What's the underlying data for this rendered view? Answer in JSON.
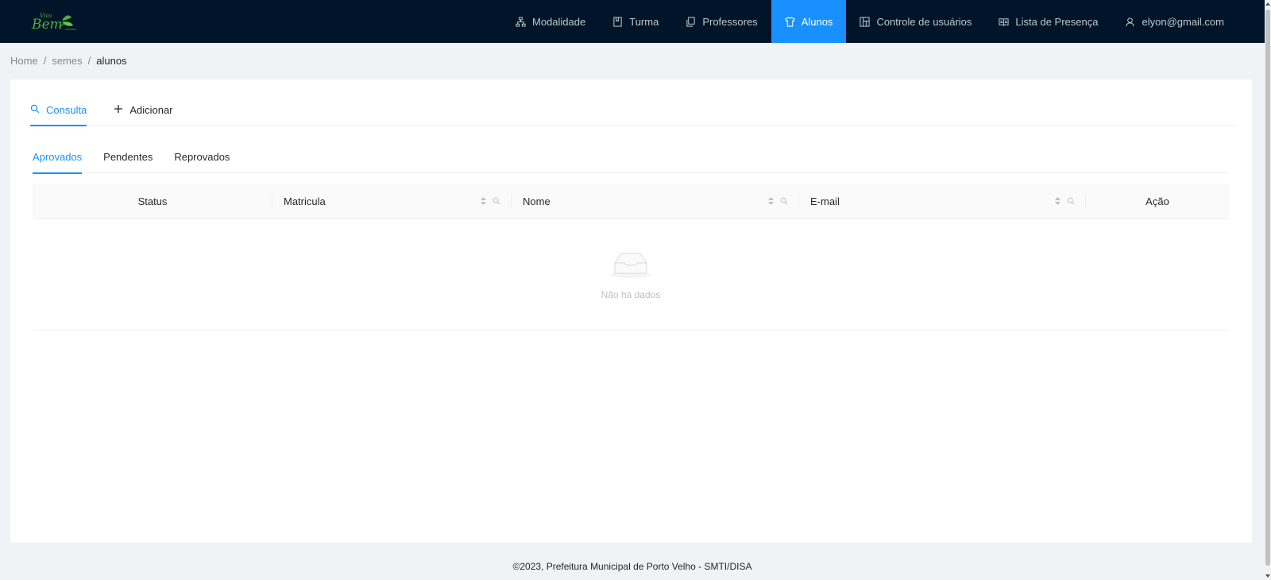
{
  "nav": {
    "logo_text": "Viva Bem",
    "items": [
      {
        "label": "Modalidade",
        "icon": "sitemap-icon"
      },
      {
        "label": "Turma",
        "icon": "book-icon"
      },
      {
        "label": "Professores",
        "icon": "copy-icon"
      },
      {
        "label": "Alunos",
        "icon": "shirt-icon",
        "active": true
      },
      {
        "label": "Controle de usuários",
        "icon": "layout-icon"
      },
      {
        "label": "Lista de Presença",
        "icon": "read-icon"
      },
      {
        "label": "elyon@gmail.com",
        "icon": "user-icon"
      }
    ]
  },
  "breadcrumb": {
    "items": [
      "Home",
      "semes",
      "alunos"
    ]
  },
  "tabs": {
    "consulta": "Consulta",
    "adicionar": "Adicionar"
  },
  "sub_tabs": {
    "aprovados": "Aprovados",
    "pendentes": "Pendentes",
    "reprovados": "Reprovados"
  },
  "table": {
    "columns": {
      "status": "Status",
      "matricula": "Matricula",
      "nome": "Nome",
      "email": "E-mail",
      "acao": "Ação"
    },
    "empty_text": "Não há dados"
  },
  "footer": {
    "text": "©2023, Prefeitura Municipal de Porto Velho - SMTI/DISA"
  },
  "colors": {
    "header_bg": "#001529",
    "accent": "#1890ff",
    "page_bg": "#f0f2f5"
  }
}
